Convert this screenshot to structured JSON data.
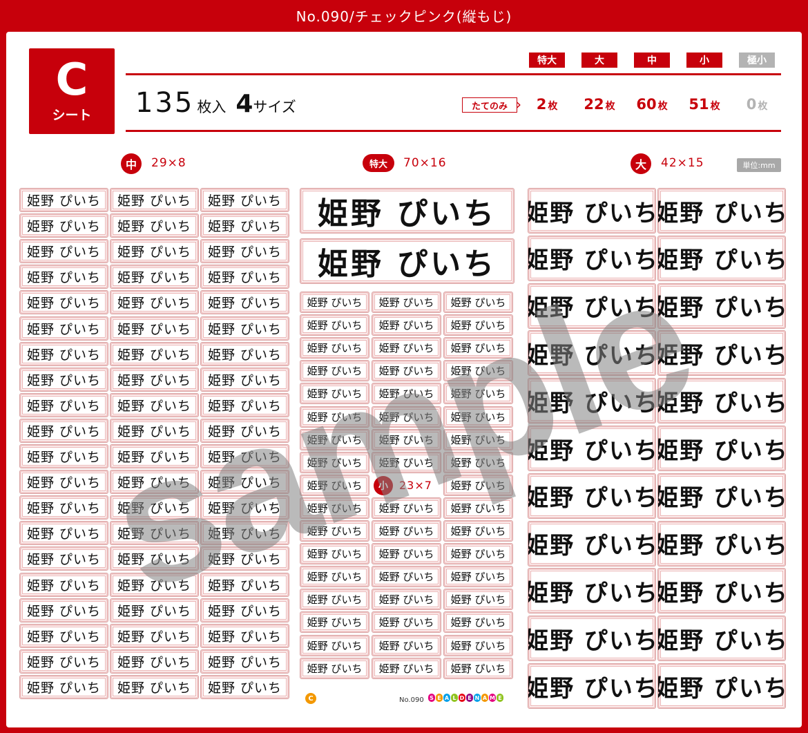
{
  "title": "No.090/チェックピンク(縦もじ)",
  "badge": {
    "letter": "C",
    "word": "シート"
  },
  "count": {
    "number": "135",
    "unit": "枚入",
    "sizes_number": "4",
    "sizes_unit": "サイズ"
  },
  "size_tags": [
    {
      "label": "特大",
      "active": true
    },
    {
      "label": "大",
      "active": true
    },
    {
      "label": "中",
      "active": true
    },
    {
      "label": "小",
      "active": true
    },
    {
      "label": "極小",
      "active": false
    }
  ],
  "orientation_label": "たてのみ",
  "counts": [
    {
      "value": "2",
      "unit": "枚",
      "active": true
    },
    {
      "value": "22",
      "unit": "枚",
      "active": true
    },
    {
      "value": "60",
      "unit": "枚",
      "active": true
    },
    {
      "value": "51",
      "unit": "枚",
      "active": true
    },
    {
      "value": "0",
      "unit": "枚",
      "active": false
    }
  ],
  "sections": {
    "mid": {
      "badge": "中",
      "dims": "29×8"
    },
    "xl": {
      "badge": "特大",
      "dims": "70×16"
    },
    "lg": {
      "badge": "大",
      "dims": "42×15"
    },
    "sm": {
      "badge": "小",
      "dims": "23×7"
    }
  },
  "unit_label": "単位:mm",
  "sticker_text": "姫野 ぴいち",
  "watermark": "sample",
  "footer": {
    "c_mark": "C",
    "number": "No.090",
    "brand": "SEALDENAME",
    "brand_colors": [
      "#e4007f",
      "#f39800",
      "#00a0e9",
      "#8fc31f",
      "#e60012",
      "#920783",
      "#00a0e9",
      "#f39800",
      "#e4007f",
      "#8fc31f"
    ]
  }
}
